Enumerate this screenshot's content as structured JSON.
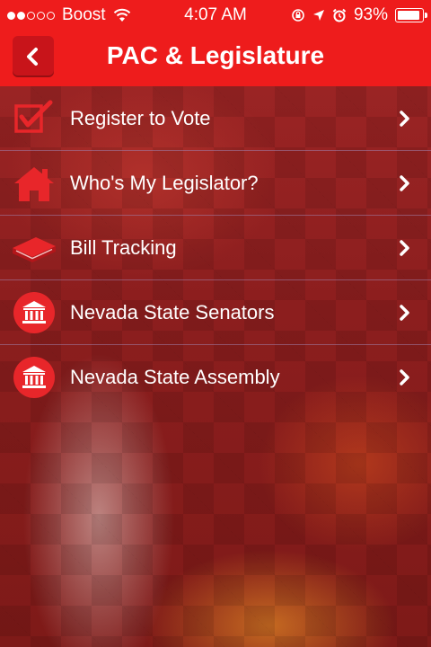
{
  "status_bar": {
    "carrier": "Boost",
    "time": "4:07 AM",
    "battery_percent": "93%",
    "battery_level": 0.93,
    "signal_bars_filled": 2,
    "signal_bars_total": 5,
    "icons": [
      "wifi-icon",
      "orientation-lock-icon",
      "location-icon",
      "alarm-icon",
      "battery-icon"
    ]
  },
  "nav": {
    "title": "PAC & Legislature",
    "back_icon": "chevron-left-icon"
  },
  "menu": [
    {
      "label": "Register to Vote",
      "icon": "checkbox-icon"
    },
    {
      "label": "Who's My Legislator?",
      "icon": "house-icon"
    },
    {
      "label": "Bill Tracking",
      "icon": "book-icon"
    },
    {
      "label": "Nevada State Senators",
      "icon": "capitol-building-icon"
    },
    {
      "label": "Nevada State Assembly",
      "icon": "capitol-building-icon"
    }
  ],
  "colors": {
    "header_red": "#ee1c1c",
    "back_button": "#c8141a",
    "icon_red": "#e8262a",
    "text": "#ffffff"
  }
}
